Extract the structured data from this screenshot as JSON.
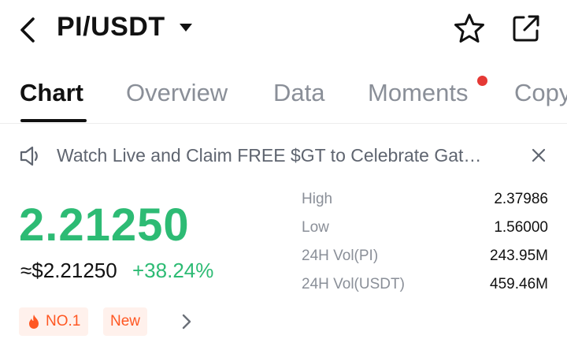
{
  "header": {
    "pair": "PI/USDT",
    "icons": [
      "back-icon",
      "caret-down-icon",
      "star-icon",
      "share-icon"
    ]
  },
  "tabs": [
    {
      "label": "Chart",
      "active": true
    },
    {
      "label": "Overview",
      "active": false
    },
    {
      "label": "Data",
      "active": false
    },
    {
      "label": "Moments",
      "active": false,
      "has_dot": true
    },
    {
      "label": "Copy",
      "active": false
    }
  ],
  "announcement": {
    "text": "Watch Live and Claim FREE $GT to Celebrate Gat…"
  },
  "price": {
    "last": "2.21250",
    "fiat": "≈$2.21250",
    "change": "+38.24%"
  },
  "stats": [
    {
      "label": "High",
      "value": "2.37986"
    },
    {
      "label": "Low",
      "value": "1.56000"
    },
    {
      "label": "24H Vol(PI)",
      "value": "243.95M"
    },
    {
      "label": "24H Vol(USDT)",
      "value": "459.46M"
    }
  ],
  "badges": {
    "rank": "NO.1",
    "new": "New"
  },
  "colors": {
    "up_green": "#2dbb74",
    "badge_orange": "#ff5722",
    "badge_bg": "#fff1ec",
    "notification_red": "#e53935"
  }
}
